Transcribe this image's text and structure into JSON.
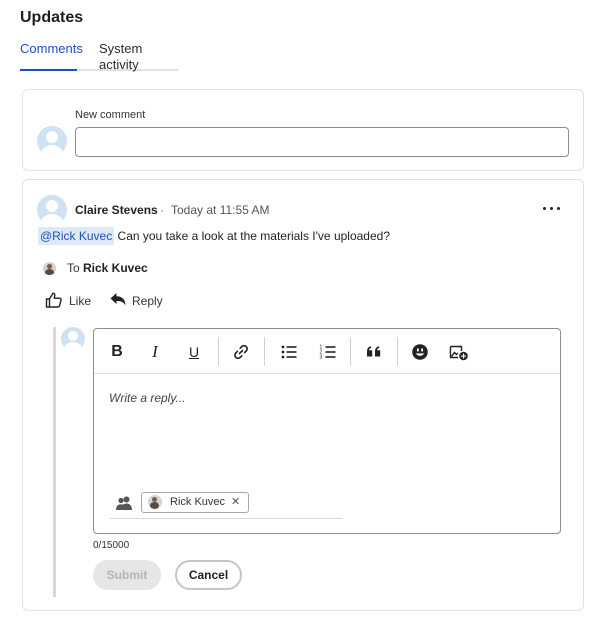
{
  "page": {
    "title": "Updates"
  },
  "tabs": [
    {
      "label": "Comments",
      "active": true
    },
    {
      "label": "System activity",
      "active": false
    }
  ],
  "new_comment": {
    "label": "New comment",
    "value": "",
    "placeholder": ""
  },
  "comment": {
    "author": "Claire Stevens",
    "separator": "·",
    "timestamp": "Today at 11:55 AM",
    "mention": "@Rick Kuvec",
    "text": " Can you take a look at the materials I've uploaded?",
    "to_prefix": "To",
    "to_name": "Rick Kuvec",
    "actions": {
      "like": "Like",
      "reply": "Reply"
    }
  },
  "reply_editor": {
    "toolbar": {
      "bold": "B",
      "italic": "I",
      "underline": "U"
    },
    "placeholder": "Write a reply...",
    "recipient_chip": "Rick Kuvec",
    "chip_remove": "✕",
    "counter": "0/15000",
    "submit_label": "Submit",
    "cancel_label": "Cancel"
  },
  "colors": {
    "accent": "#1c4fbf",
    "mention_bg": "#dceaf8",
    "disabled_bg": "#e6e6e6",
    "avatar_bg": "#cfe2f3"
  },
  "icons": {
    "more": "more-horizontal-icon",
    "like": "thumbs-up-icon",
    "reply": "reply-arrow-icon",
    "link": "link-icon",
    "bullet_list": "bullet-list-icon",
    "numbered_list": "numbered-list-icon",
    "quote": "quote-icon",
    "emoji": "emoji-icon",
    "image": "add-image-icon",
    "people": "people-icon"
  }
}
